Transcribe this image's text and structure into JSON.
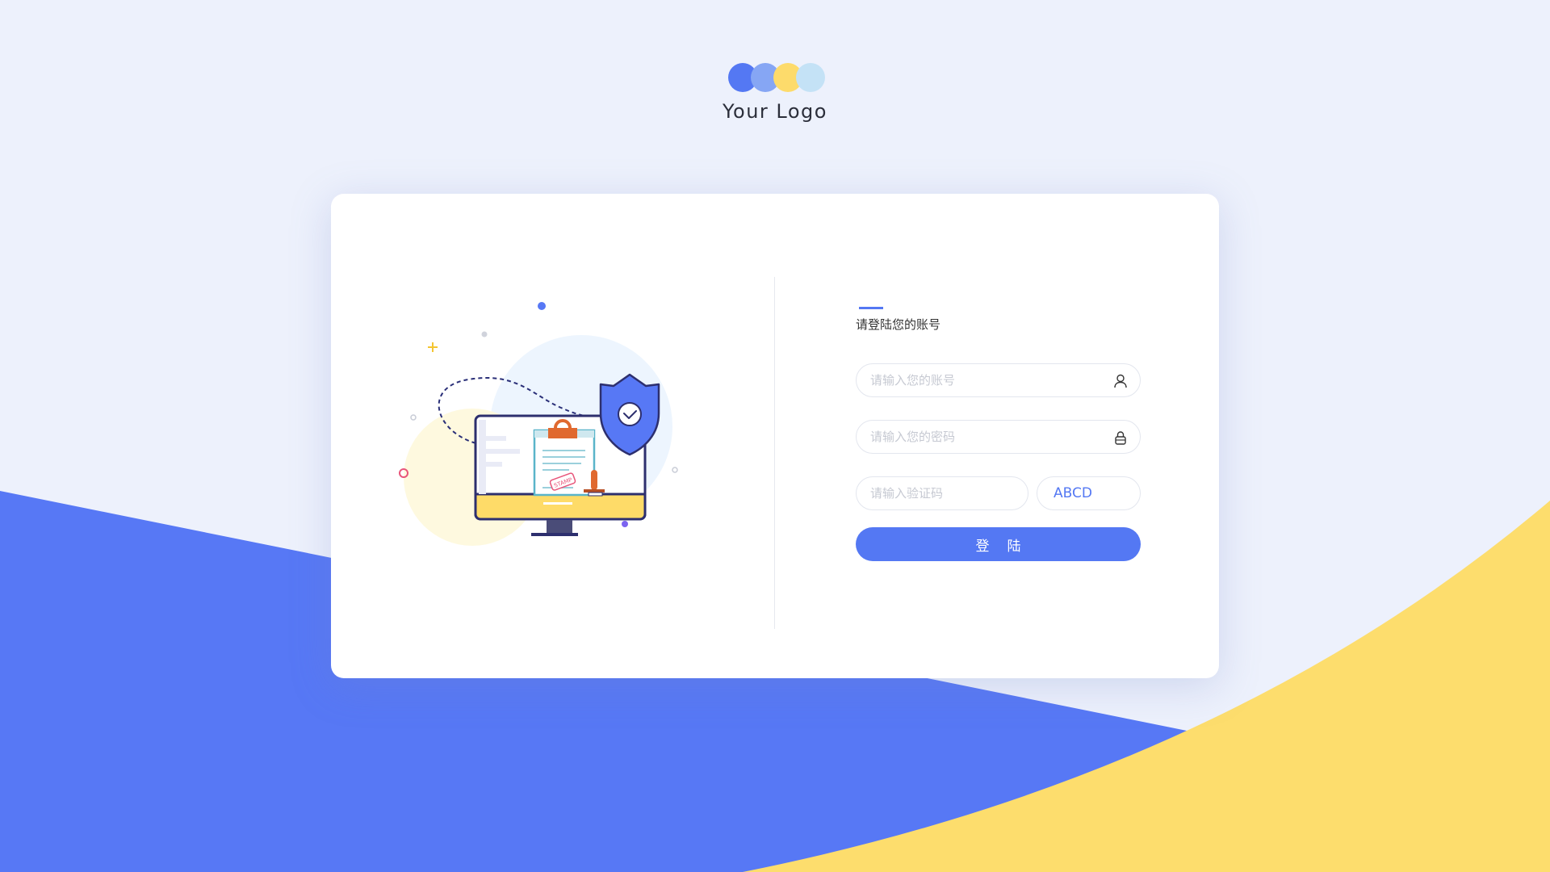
{
  "logo": {
    "text": "Your Logo"
  },
  "form": {
    "title": "请登陆您的账号",
    "username_placeholder": "请输入您的账号",
    "password_placeholder": "请输入您的密码",
    "captcha_placeholder": "请输入验证码",
    "captcha_text": "ABCD",
    "submit_label": "登陆"
  },
  "illustration": {
    "stamp_text": "STAMP"
  },
  "colors": {
    "background": "#edf1fc",
    "primary": "#5478f3",
    "accent_yellow": "#fddb6b",
    "card": "#ffffff"
  },
  "icons": [
    "user-icon",
    "lock-icon",
    "shield-check-icon",
    "monitor-icon"
  ]
}
